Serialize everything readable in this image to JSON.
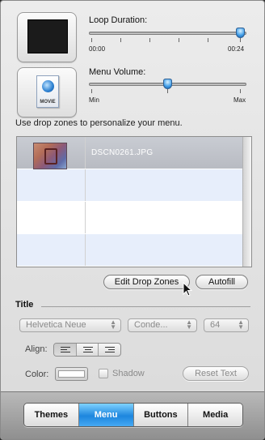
{
  "loop": {
    "label": "Loop Duration:",
    "min_label": "00:00",
    "max_label": "00:24",
    "value_fraction": 1.0
  },
  "menu_volume": {
    "label": "Menu Volume:",
    "min_label": "Min",
    "max_label": "Max",
    "value_fraction": 0.5
  },
  "audio_well": {
    "icon": "movie-file-icon",
    "icon_text": "MOVIE"
  },
  "drop_zones": {
    "description": "Use drop zones to personalize your menu.",
    "rows": [
      {
        "name": "DSCN0261.JPG",
        "selected": true
      }
    ],
    "edit_button": "Edit Drop Zones",
    "autofill_button": "Autofill"
  },
  "title_section": {
    "heading": "Title",
    "font_family": "Helvetica Neue",
    "font_style": "Conde...",
    "font_size": "64",
    "align_label": "Align:",
    "color_label": "Color:",
    "shadow_label": "Shadow",
    "reset_button": "Reset Text"
  },
  "tabs": {
    "items": [
      "Themes",
      "Menu",
      "Buttons",
      "Media"
    ],
    "active": "Menu"
  },
  "colors": {
    "accent_blue": "#1d86de",
    "selected_row": "#c0c3ca",
    "alt_row": "#e7eefb"
  }
}
